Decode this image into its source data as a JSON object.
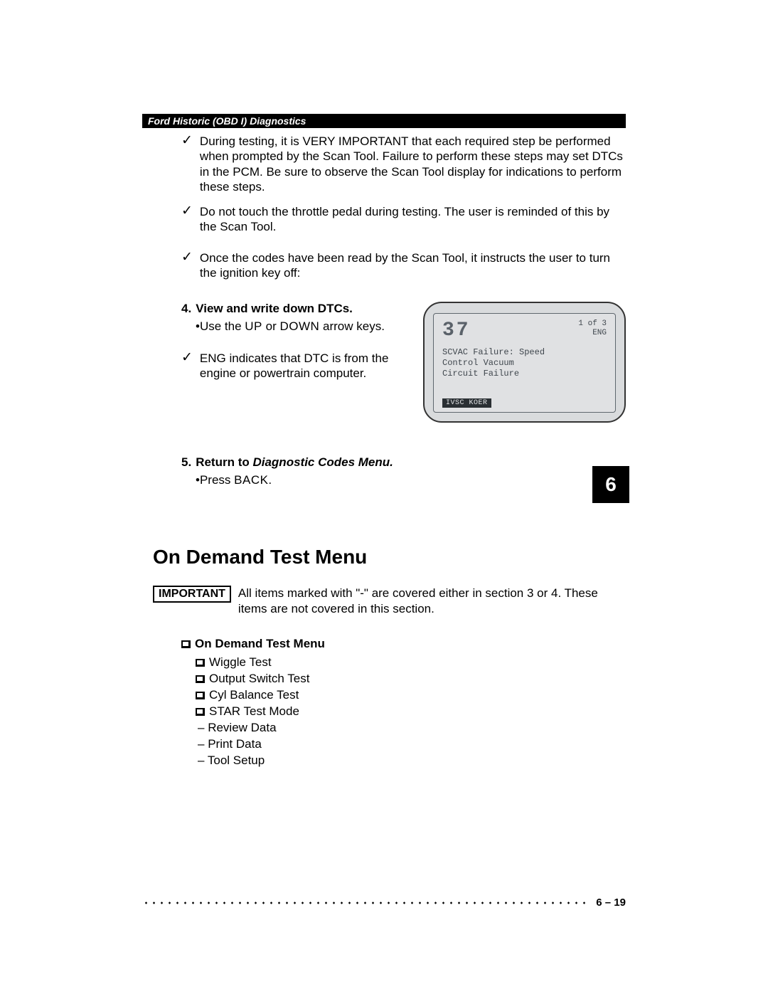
{
  "header": {
    "title": "Ford Historic (OBD I) Diagnostics"
  },
  "checks": {
    "c1": "During testing, it is VERY IMPORTANT that each required step be performed when prompted by the Scan Tool. Failure to perform these steps may set DTCs in the PCM. Be sure to observe the Scan Tool display for indications to perform these steps.",
    "c2": "Do not touch the throttle pedal during testing. The user is reminded of this by the Scan Tool.",
    "c3": "Once the codes have been read by the Scan Tool, it instructs the user to turn the ignition key off:"
  },
  "step4": {
    "num": "4.",
    "title": "View and write down DTCs.",
    "bullet_prefix": "•Use the ",
    "kw_up": "UP",
    "mid": " or ",
    "kw_down": "DOWN",
    "suffix": " arrow keys."
  },
  "eng_note": "ENG indicates that DTC is from the engine or powertrain computer.",
  "screen": {
    "code": "37",
    "count": "1 of 3",
    "mode": "ENG",
    "line1": "SCVAC Failure: Speed",
    "line2": "Control Vacuum",
    "line3": "Circuit Failure",
    "footer": "IVSC KOER"
  },
  "step5": {
    "num": "5.",
    "title_a": "Return to ",
    "title_b": "Diagnostic Codes Menu.",
    "bullet_prefix": "•Press ",
    "kw_back": "BACK."
  },
  "chapter": "6",
  "section_title": "On Demand Test Menu",
  "important": {
    "label": "IMPORTANT",
    "text": "All items marked with \"-\" are covered either in section 3 or 4. These items are not covered in this section."
  },
  "menu": {
    "head": "On Demand Test Menu",
    "box_items": [
      "Wiggle Test",
      "Output Switch Test",
      "Cyl Balance Test",
      "STAR Test Mode"
    ],
    "dash_items": [
      "Review Data",
      "Print Data",
      "Tool Setup"
    ]
  },
  "page_number": "6 – 19"
}
